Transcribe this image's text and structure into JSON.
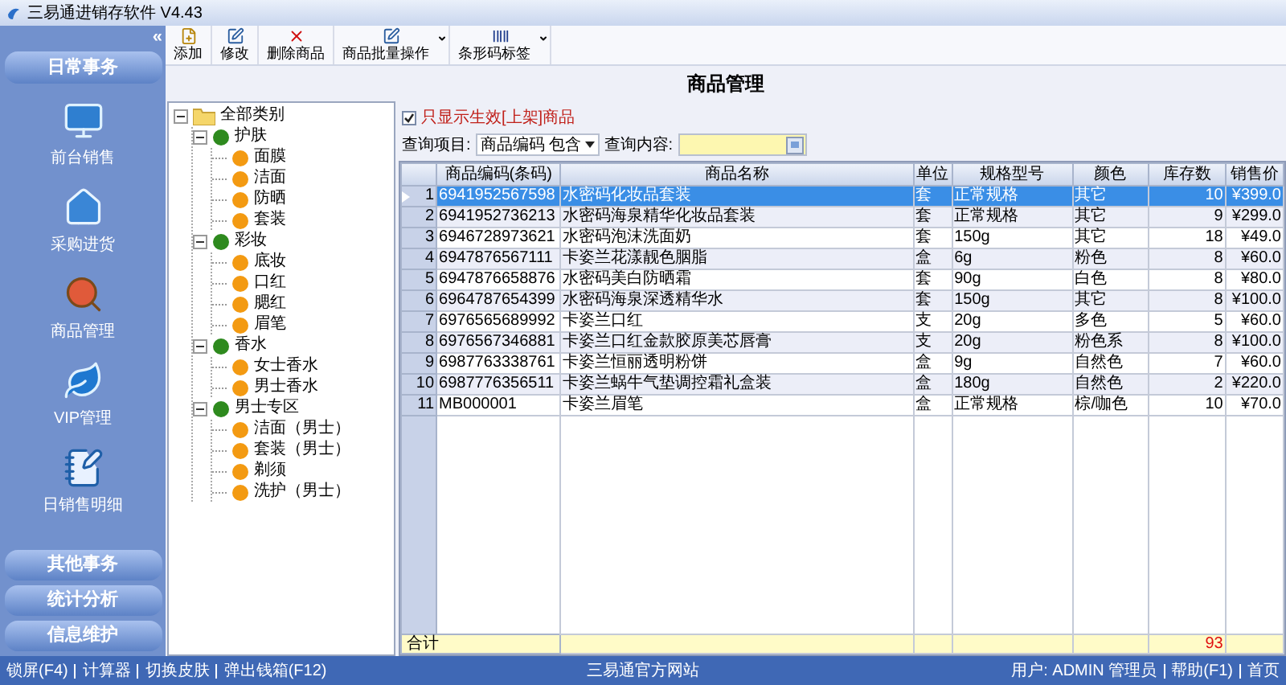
{
  "window": {
    "title": "三易通进销存软件 V4.43"
  },
  "sidebar": {
    "collapse": "«",
    "header": "日常事务",
    "items": [
      {
        "label": "前台销售"
      },
      {
        "label": "采购进货"
      },
      {
        "label": "商品管理"
      },
      {
        "label": "VIP管理"
      },
      {
        "label": "日销售明细"
      }
    ],
    "sections": [
      "其他事务",
      "统计分析",
      "信息维护"
    ]
  },
  "toolbar": [
    {
      "label": "添加",
      "dropdown": false
    },
    {
      "label": "修改",
      "dropdown": false
    },
    {
      "label": "删除商品",
      "dropdown": false
    },
    {
      "label": "商品批量操作",
      "dropdown": true
    },
    {
      "label": "条形码标签",
      "dropdown": true
    }
  ],
  "page_title": "商品管理",
  "tree": [
    {
      "label": "全部类别",
      "expanded": true,
      "children": [
        {
          "label": "护肤",
          "expanded": true,
          "children": [
            {
              "label": "面膜"
            },
            {
              "label": "洁面"
            },
            {
              "label": "防晒"
            },
            {
              "label": "套装"
            }
          ]
        },
        {
          "label": "彩妆",
          "expanded": true,
          "children": [
            {
              "label": "底妆"
            },
            {
              "label": "口红"
            },
            {
              "label": "腮红"
            },
            {
              "label": "眉笔"
            }
          ]
        },
        {
          "label": "香水",
          "expanded": true,
          "children": [
            {
              "label": "女士香水"
            },
            {
              "label": "男士香水"
            }
          ]
        },
        {
          "label": "男士专区",
          "expanded": true,
          "children": [
            {
              "label": "洁面（男士）"
            },
            {
              "label": "套装（男士）"
            },
            {
              "label": "剃须"
            },
            {
              "label": "洗护（男士）"
            }
          ]
        }
      ]
    }
  ],
  "filter": {
    "label": "只显示生效[上架]商品",
    "checked": true
  },
  "query": {
    "item_label": "查询项目:",
    "item_value": "商品编码 包含",
    "content_label": "查询内容:"
  },
  "table": {
    "columns": [
      "商品编码(条码)",
      "商品名称",
      "单位",
      "规格型号",
      "颜色",
      "库存数",
      "销售价"
    ],
    "rows": [
      {
        "no": "1",
        "cells": [
          "6941952567598",
          "水密码化妆品套装",
          "套",
          "正常规格",
          "其它",
          "10",
          "¥399.0"
        ],
        "selected": true
      },
      {
        "no": "2",
        "cells": [
          "6941952736213",
          "水密码海泉精华化妆品套装",
          "套",
          "正常规格",
          "其它",
          "9",
          "¥299.0"
        ],
        "selected": false
      },
      {
        "no": "3",
        "cells": [
          "6946728973621",
          "水密码泡沫洗面奶",
          "套",
          "150g",
          "其它",
          "18",
          "¥49.0"
        ],
        "selected": false
      },
      {
        "no": "4",
        "cells": [
          "6947876567111",
          "卡姿兰花漾靓色胭脂",
          "盒",
          "6g",
          "粉色",
          "8",
          "¥60.0"
        ],
        "selected": false
      },
      {
        "no": "5",
        "cells": [
          "6947876658876",
          "水密码美白防晒霜",
          "套",
          "90g",
          "白色",
          "8",
          "¥80.0"
        ],
        "selected": false
      },
      {
        "no": "6",
        "cells": [
          "6964787654399",
          "水密码海泉深透精华水",
          "套",
          "150g",
          "其它",
          "8",
          "¥100.0"
        ],
        "selected": false
      },
      {
        "no": "7",
        "cells": [
          "6976565689992",
          "卡姿兰口红",
          "支",
          "20g",
          "多色",
          "5",
          "¥60.0"
        ],
        "selected": false
      },
      {
        "no": "8",
        "cells": [
          "6976567346881",
          "卡姿兰口红金款胶原美芯唇膏",
          "支",
          "20g",
          "粉色系",
          "8",
          "¥100.0"
        ],
        "selected": false
      },
      {
        "no": "9",
        "cells": [
          "6987763338761",
          "卡姿兰恒丽透明粉饼",
          "盒",
          "9g",
          "自然色",
          "7",
          "¥60.0"
        ],
        "selected": false
      },
      {
        "no": "10",
        "cells": [
          "6987776356511",
          "卡姿兰蜗牛气垫调控霜礼盒装",
          "盒",
          "180g",
          "自然色",
          "2",
          "¥220.0"
        ],
        "selected": false
      },
      {
        "no": "11",
        "cells": [
          "MB000001",
          "卡姿兰眉笔",
          "盒",
          "正常规格",
          "棕/咖色",
          "10",
          "¥70.0"
        ],
        "selected": false
      }
    ],
    "total_label": "合计",
    "total_stock": "93"
  },
  "status_bar": {
    "left": [
      "锁屏(F4)",
      "计算器",
      "切换皮肤",
      "弹出钱箱(F12)"
    ],
    "center": "三易通官方网站",
    "right": [
      "用户: ADMIN 管理员",
      "帮助(F1)",
      "首页"
    ]
  }
}
